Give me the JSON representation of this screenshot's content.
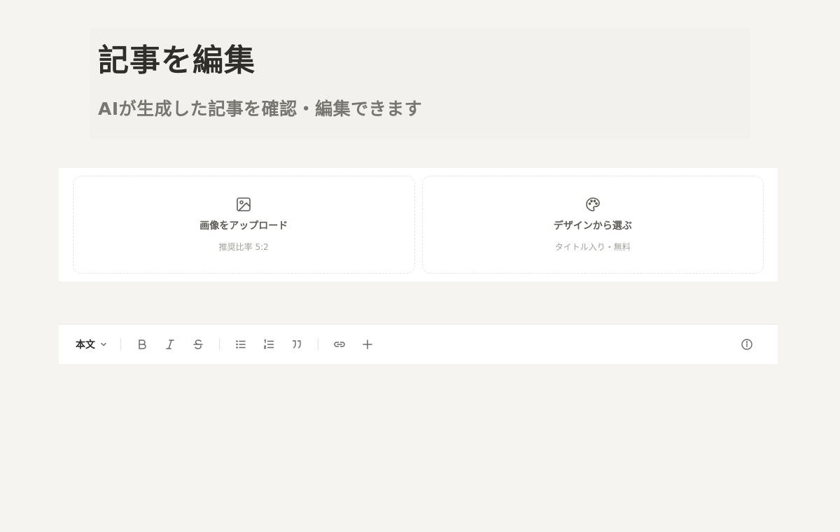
{
  "header": {
    "title": "記事を編集",
    "subtitle": "AIが生成した記事を確認・編集できます"
  },
  "cover_options": [
    {
      "icon": "image-icon",
      "title": "画像をアップロード",
      "hint": "推奨比率 5:2"
    },
    {
      "icon": "palette-icon",
      "title": "デザインから選ぶ",
      "hint": "タイトル入り・無料"
    }
  ],
  "toolbar": {
    "block_type": "本文",
    "buttons": [
      "bold",
      "italic",
      "strikethrough",
      "bullet-list",
      "numbered-list",
      "quote",
      "link",
      "insert",
      "info"
    ]
  },
  "colors": {
    "page_bg": "#f5f4f1",
    "panel_bg": "#ffffff",
    "text_primary": "#2f2e2a",
    "text_muted": "#787670"
  }
}
